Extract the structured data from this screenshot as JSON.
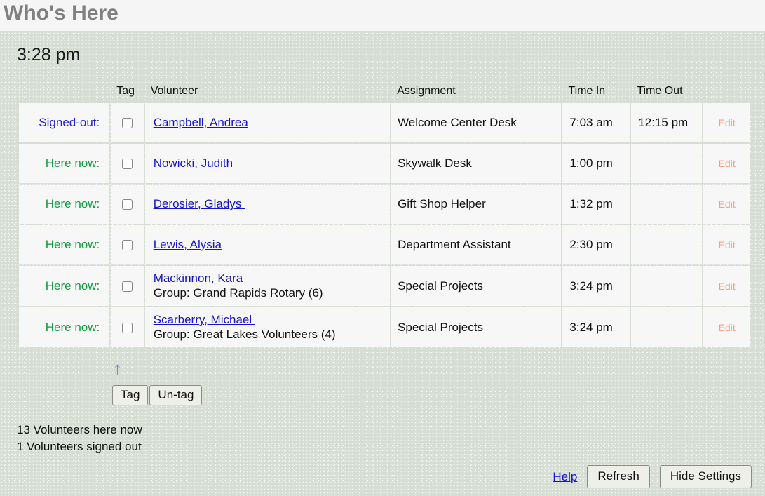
{
  "header": {
    "title": "Who's Here",
    "clock": "3:28 pm"
  },
  "table": {
    "columns": {
      "status": "",
      "tag": "Tag",
      "volunteer": "Volunteer",
      "assignment": "Assignment",
      "time_in": "Time In",
      "time_out": "Time Out",
      "edit": ""
    },
    "rows": [
      {
        "status": "Signed-out:",
        "status_kind": "signedout",
        "volunteer": "Campbell, Andrea",
        "group": "",
        "assignment": "Welcome Center Desk",
        "time_in": "7:03 am",
        "time_out": "12:15 pm",
        "edit": "Edit"
      },
      {
        "status": "Here now:",
        "status_kind": "here",
        "volunteer": "Nowicki, Judith",
        "group": "",
        "assignment": "Skywalk Desk",
        "time_in": "1:00 pm",
        "time_out": "",
        "edit": "Edit"
      },
      {
        "status": "Here now:",
        "status_kind": "here",
        "volunteer": "Derosier, Gladys ",
        "group": "",
        "assignment": "Gift Shop Helper",
        "time_in": "1:32 pm",
        "time_out": "",
        "edit": "Edit"
      },
      {
        "status": "Here now:",
        "status_kind": "here",
        "volunteer": "Lewis, Alysia",
        "group": "",
        "assignment": "Department Assistant",
        "time_in": "2:30 pm",
        "time_out": "",
        "edit": "Edit"
      },
      {
        "status": "Here now:",
        "status_kind": "here",
        "volunteer": "Mackinnon, Kara",
        "group": "Group: Grand Rapids Rotary (6)",
        "assignment": "Special Projects",
        "time_in": "3:24 pm",
        "time_out": "",
        "edit": "Edit"
      },
      {
        "status": "Here now:",
        "status_kind": "here",
        "volunteer": "Scarberry, Michael ",
        "group": "Group: Great Lakes Volunteers (4)",
        "assignment": "Special Projects",
        "time_in": "3:24 pm",
        "time_out": "",
        "edit": "Edit"
      }
    ]
  },
  "tag_controls": {
    "arrow_icon": "up-arrow-icon",
    "arrow_glyph": "↑",
    "tag_label": "Tag",
    "untag_label": "Un-tag"
  },
  "summary": {
    "here_now": "13 Volunteers here now",
    "signed_out": "1 Volunteers signed out"
  },
  "footer": {
    "help_label": "Help",
    "refresh_label": "Refresh",
    "hide_settings_label": "Hide Settings"
  },
  "colors": {
    "page_background": "#d6ded4",
    "titlebar_background": "#f5f5f5",
    "title_text": "#808080",
    "cell_background": "#f7f7f7",
    "here_now_text": "#0b9e3c",
    "signed_out_text": "#2222cc",
    "link_text": "#1414cc",
    "edit_link_text": "#f9a07a",
    "arrow": "#8a7fd4"
  }
}
